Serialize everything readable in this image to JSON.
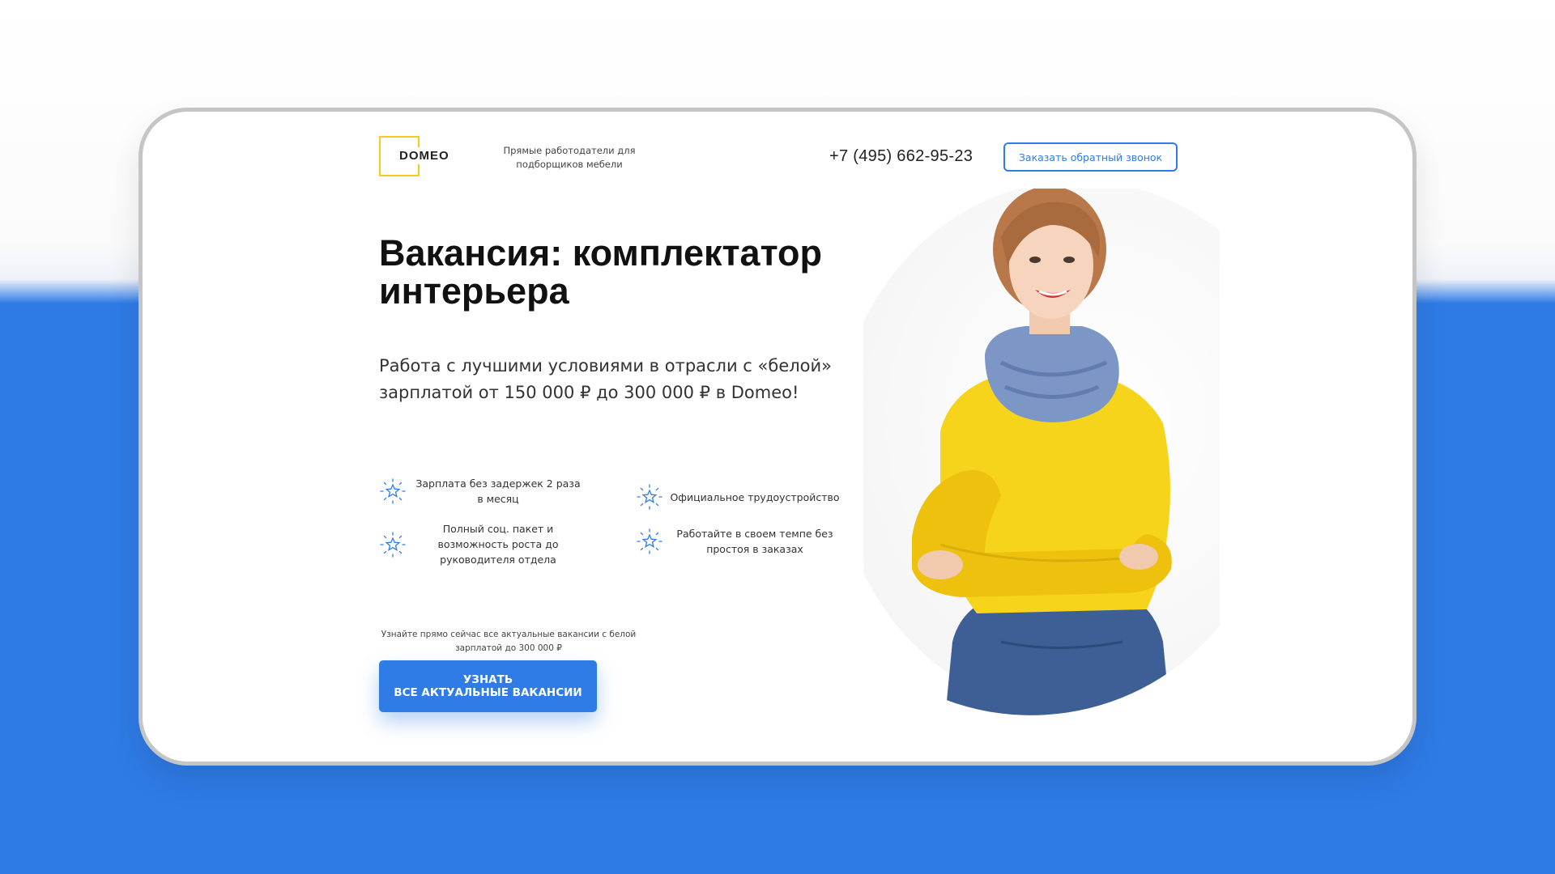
{
  "header": {
    "logo_text": "DOMEO",
    "tagline": "Прямые работодатели для подборщиков мебели",
    "phone": "+7 (495) 662-95-23",
    "callback_button": "Заказать обратный звонок"
  },
  "hero": {
    "title": "Вакансия: комплектатор интерьера",
    "subtitle": "Работа с лучшими условиями в отрасли с «белой» зарплатой от 150 000 ₽ до 300 000 ₽ в Domeo!"
  },
  "features": [
    {
      "text": "Зарплата без задержек 2 раза в месяц",
      "icon": "star-burst-icon"
    },
    {
      "text": "Официальное трудоустройство",
      "icon": "star-burst-icon"
    },
    {
      "text": "Полный соц. пакет и возможность роста до руководителя отдела",
      "icon": "star-burst-icon"
    },
    {
      "text": "Работайте в своем темпе без простоя в заказах",
      "icon": "star-burst-icon"
    }
  ],
  "cta": {
    "note": "Узнайте прямо сейчас все актуальные вакансии с белой зарплатой до 300 000 ₽",
    "button": "УЗНАТЬ\nВСЕ АКТУАЛЬНЫЕ ВАКАНСИИ"
  },
  "colors": {
    "accent_blue": "#2f7ce6",
    "logo_yellow": "#f5cc1d",
    "sweater_yellow": "#f7d41c",
    "scarf_blue": "#7c97c6"
  }
}
